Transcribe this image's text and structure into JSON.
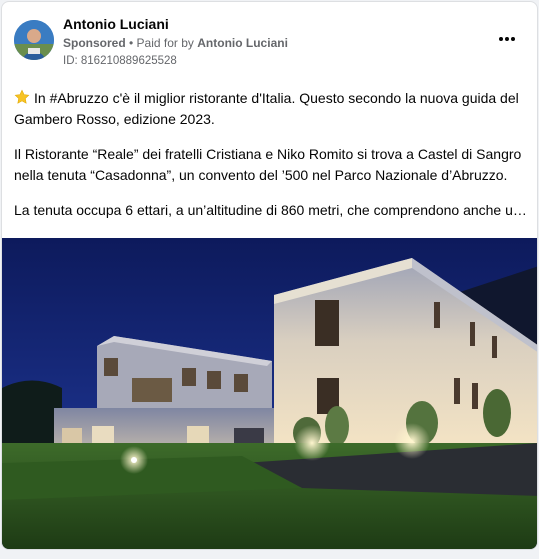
{
  "post": {
    "author": "Antonio Luciani",
    "sponsored": "Sponsored",
    "paid_prefix": " • Paid for by ",
    "paid_by": "Antonio Luciani",
    "id_text": "ID: 816210889625528",
    "more_icon": "more-horizontal-icon",
    "paragraphs": [
      "In #Abruzzo c'è il miglior ristorante d'Italia. Questo secondo la nuova guida del Gambero Rosso, edizione 2023.",
      "Il Ristorante “Reale” dei fratelli Cristiana e Niko Romito si trova a Castel di Sangro nella tenuta “Casadonna”, un convento del ’500 nel Parco Nazionale d’Abruzzo.",
      "La tenuta occupa 6 ettari, a un’altitudine di 860 metri, che comprendono anche un…"
    ],
    "first_paragraph_icon": "star-emoji-icon",
    "image_description_icon": "illuminated-building-photo"
  },
  "colors": {
    "card_bg": "#ffffff",
    "page_bg": "#f0f2f5",
    "text": "#050505",
    "secondary_text": "#65676b",
    "star": "#f7c325"
  }
}
